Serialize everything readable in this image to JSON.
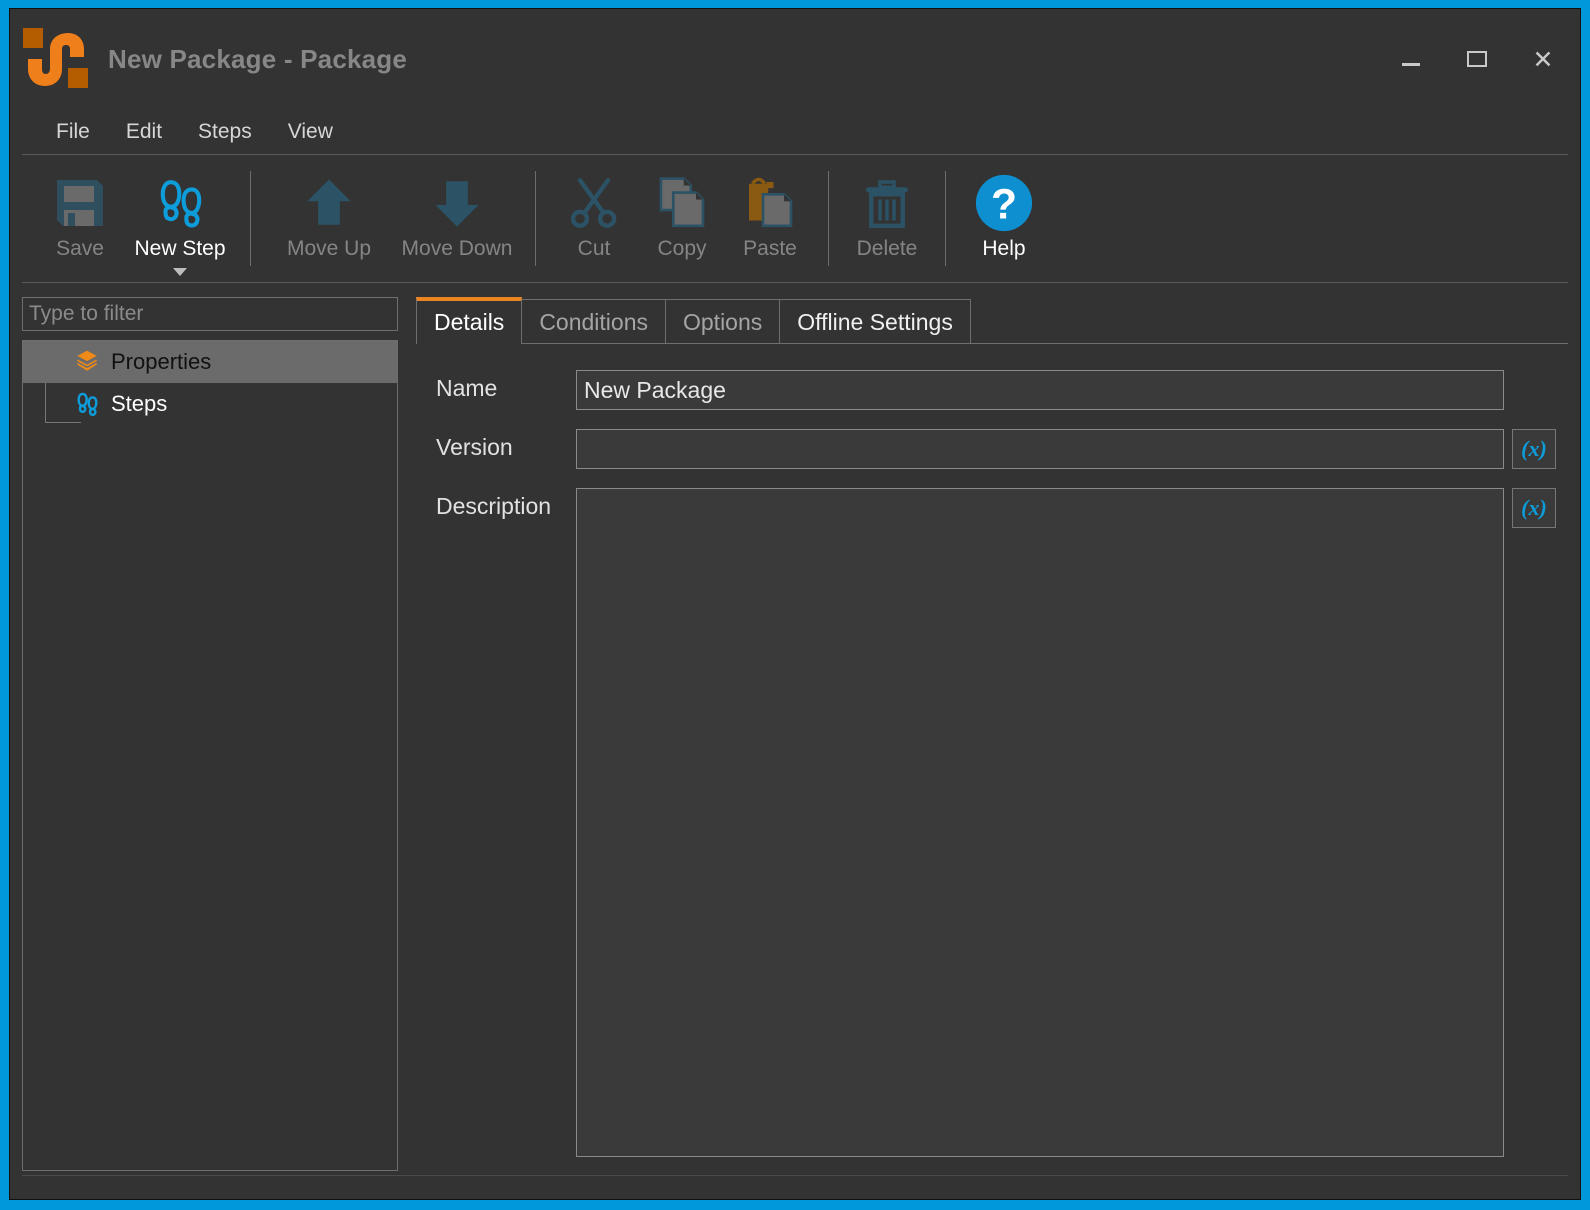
{
  "window": {
    "title": "New Package - Package",
    "logo_icon": "package-s-logo",
    "controls": {
      "minimize": "minimize-icon",
      "maximize": "maximize-icon",
      "close": "close-icon"
    },
    "accent_border_color": "#0098d8",
    "background_color": "#333333"
  },
  "menu": {
    "items": [
      {
        "label": "File"
      },
      {
        "label": "Edit"
      },
      {
        "label": "Steps"
      },
      {
        "label": "View"
      }
    ]
  },
  "toolbar": {
    "buttons": [
      {
        "label": "Save",
        "icon": "floppy-disk-icon",
        "enabled": false,
        "has_dropdown": false
      },
      {
        "label": "New Step",
        "icon": "footprints-icon",
        "enabled": true,
        "has_dropdown": true
      },
      {
        "label": "Move Up",
        "icon": "arrow-up-icon",
        "enabled": false,
        "has_dropdown": false
      },
      {
        "label": "Move Down",
        "icon": "arrow-down-icon",
        "enabled": false,
        "has_dropdown": false
      },
      {
        "label": "Cut",
        "icon": "scissors-icon",
        "enabled": false,
        "has_dropdown": false
      },
      {
        "label": "Copy",
        "icon": "copy-pages-icon",
        "enabled": false,
        "has_dropdown": false
      },
      {
        "label": "Paste",
        "icon": "clipboard-paste-icon",
        "enabled": false,
        "has_dropdown": false
      },
      {
        "label": "Delete",
        "icon": "trash-can-icon",
        "enabled": false,
        "has_dropdown": false
      },
      {
        "label": "Help",
        "icon": "question-mark-circle-icon",
        "enabled": true,
        "has_dropdown": false
      }
    ]
  },
  "sidebar": {
    "filter": {
      "value": "",
      "placeholder": "Type to filter"
    },
    "tree": [
      {
        "label": "Properties",
        "icon": "orange-package-icon",
        "selected": true
      },
      {
        "label": "Steps",
        "icon": "blue-footprints-icon",
        "selected": false
      }
    ]
  },
  "tabs": [
    {
      "label": "Details",
      "active": true,
      "bright": true
    },
    {
      "label": "Conditions",
      "active": false,
      "bright": false
    },
    {
      "label": "Options",
      "active": false,
      "bright": false
    },
    {
      "label": "Offline Settings",
      "active": false,
      "bright": true
    }
  ],
  "details": {
    "name": {
      "label": "Name",
      "value": "New Package",
      "placeholder": ""
    },
    "version": {
      "label": "Version",
      "value": "",
      "placeholder": "",
      "expr_button": "(x)"
    },
    "description": {
      "label": "Description",
      "value": "",
      "placeholder": "",
      "expr_button": "(x)"
    }
  },
  "status_bar": {
    "text": ""
  },
  "colors": {
    "accent_blue": "#0098d8",
    "accent_orange": "#ea8521",
    "panel_bg": "#333333",
    "field_bg": "#3a3a3a",
    "disabled_text": "#858585"
  }
}
